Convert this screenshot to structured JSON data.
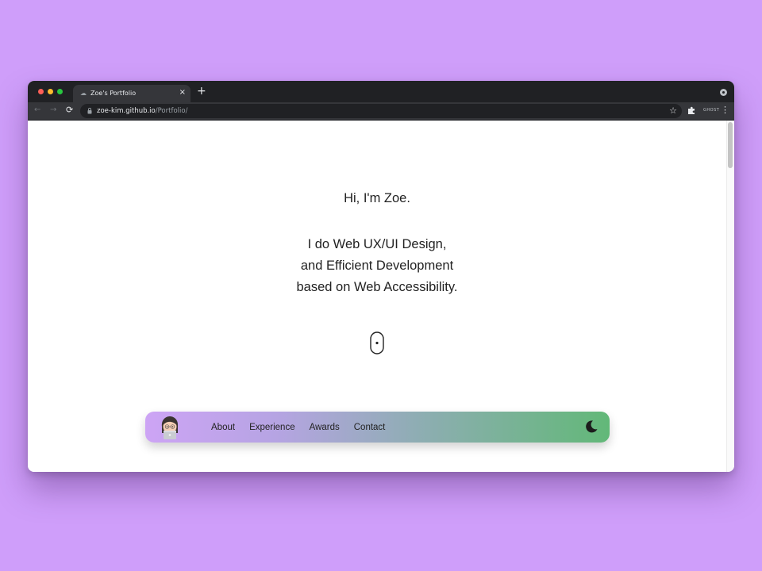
{
  "browser": {
    "tab_title": "Zoe's Portfolio",
    "tab_close": "×",
    "new_tab": "+",
    "url_host": "zoe-kim.github.io",
    "url_path": "/Portfolio/",
    "nav_back": "←",
    "nav_forward": "→",
    "nav_reload": "C",
    "star": "☆",
    "menu": "⋮",
    "extension_label": "GHOST"
  },
  "hero": {
    "greeting": "Hi, I'm Zoe.",
    "line1": "I do Web UX/UI Design,",
    "line2": "and Efficient Development",
    "line3": "based on Web Accessibility."
  },
  "navbar": {
    "links": [
      "About",
      "Experience",
      "Awards",
      "Contact"
    ],
    "gradient": [
      "#cda4f5",
      "#62b878"
    ]
  },
  "icons": {
    "scroll": "mouse-scroll-icon",
    "theme": "moon-icon",
    "avatar": "memoji-avatar"
  },
  "colors": {
    "background": "#cf9efa",
    "browser_chrome": "#202124",
    "text": "#222222"
  }
}
